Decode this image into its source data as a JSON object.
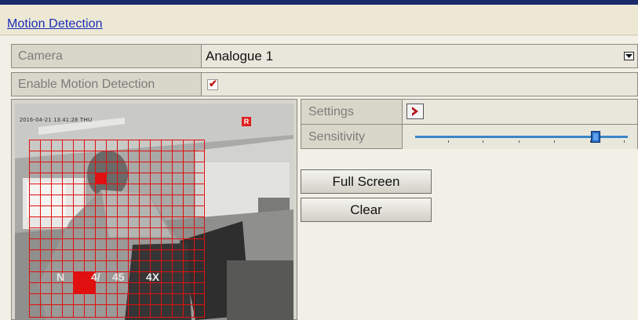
{
  "page": {
    "title": "Motion Detection"
  },
  "camera": {
    "label": "Camera",
    "value": "Analogue 1"
  },
  "enable_motion": {
    "label": "Enable Motion Detection",
    "checked": true,
    "check_glyph": "✔"
  },
  "preview": {
    "rec_badge": "R",
    "osd_text": "2016-04-21 13:41:28 THU",
    "overlay_texts": [
      "N",
      "4/",
      "45",
      "4X"
    ]
  },
  "settings": {
    "label": "Settings",
    "button_icon": "chevron-right-icon"
  },
  "sensitivity": {
    "label": "Sensitivity",
    "level_fraction": 0.85
  },
  "buttons": {
    "full_screen": "Full Screen",
    "clear": "Clear"
  },
  "colors": {
    "title_link": "#1a2db8",
    "grid": "#e01010",
    "slider": "#3a86c8",
    "header_bar": "#1b2a6b"
  }
}
